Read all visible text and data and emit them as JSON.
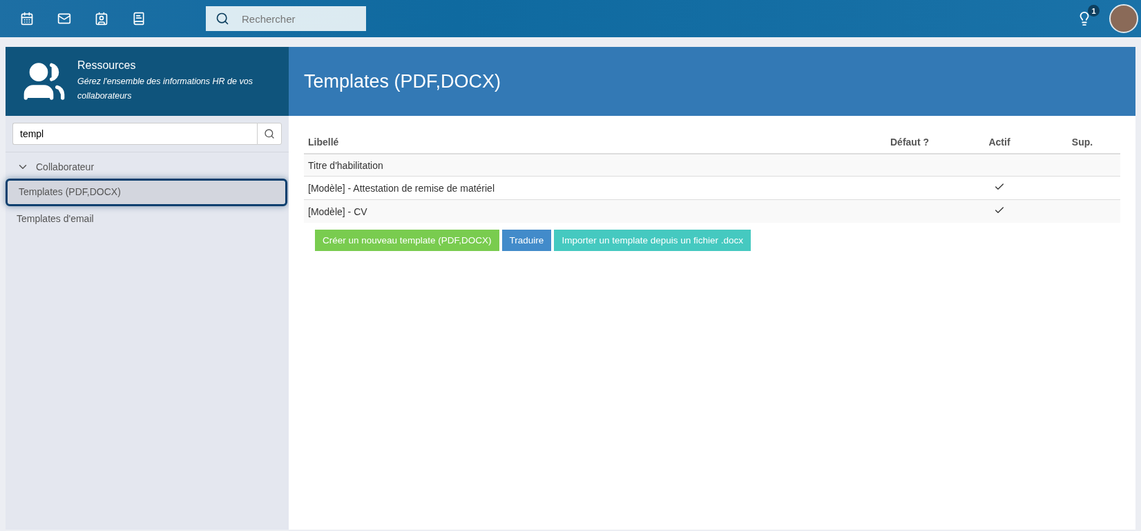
{
  "topbar": {
    "search": {
      "placeholder": "Rechercher"
    },
    "notifications": {
      "count": "1"
    }
  },
  "module": {
    "title": "Ressources",
    "subtitle": "Gérez l'ensemble des informations HR de vos collaborateurs"
  },
  "sidebar": {
    "search": {
      "value": "templ"
    },
    "groups": [
      {
        "label": "Collaborateur",
        "expanded": true,
        "children": [
          {
            "label": "Templates (PDF,DOCX)",
            "selected": true
          },
          {
            "label": "Templates d'email",
            "selected": false
          }
        ]
      }
    ]
  },
  "page": {
    "title": "Templates (PDF,DOCX)"
  },
  "table": {
    "columns": [
      "Libellé",
      "Défaut ?",
      "Actif",
      "Sup."
    ],
    "rows": [
      {
        "label": "Titre d'habilitation",
        "active": false
      },
      {
        "label": "[Modèle] - Attestation de remise de matériel",
        "active": true
      },
      {
        "label": "[Modèle] - CV",
        "active": true
      }
    ]
  },
  "buttons": [
    {
      "label": "Créer un nouveau template (PDF,DOCX)",
      "kind": "success"
    },
    {
      "label": "Traduire",
      "kind": "primary"
    },
    {
      "label": "Importer un template depuis un fichier .docx",
      "kind": "info"
    }
  ]
}
